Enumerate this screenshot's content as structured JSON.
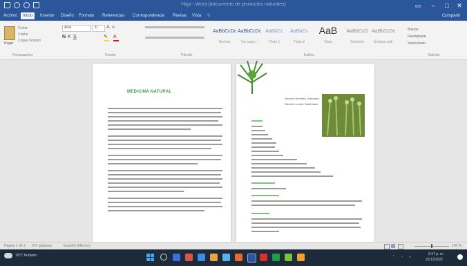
{
  "window": {
    "title": "Hoja - Word (documento de productos naturales)",
    "controls": [
      "minimize",
      "maximize",
      "close"
    ]
  },
  "quick_access": [
    "save-icon",
    "undo-icon",
    "redo-icon",
    "customize-icon"
  ],
  "ribbon_tabs": [
    "Archivo",
    "Inicio",
    "Insertar",
    "Diseño",
    "Formato",
    "Referencias",
    "Correspondencia",
    "Revisar",
    "Vista"
  ],
  "share_label": "Compartir",
  "ribbon": {
    "clipboard_label": "Portapapeles",
    "font_label": "Fuente",
    "paragraph_label": "Párrafo",
    "styles_label": "Estilos",
    "editing_label": "Edición",
    "paste_label": "Pegar",
    "cut_label": "Cortar",
    "copy_label": "Copiar",
    "format_painter_label": "Copiar formato",
    "font_name": "Arial",
    "font_size": "11",
    "styles": [
      {
        "sample": "AaBbCcDc",
        "name": "Normal"
      },
      {
        "sample": "AaBbCcDc",
        "name": "Sin espa..."
      },
      {
        "sample": "AaBbCc",
        "name": "Título 1"
      },
      {
        "sample": "AaBbCc",
        "name": "Título 2"
      },
      {
        "sample": "AaB",
        "name": "Título"
      },
      {
        "sample": "AaBbCcD",
        "name": "Subtítulo"
      },
      {
        "sample": "AaBbCcDc",
        "name": "Énfasis sutil"
      }
    ],
    "find_label": "Buscar",
    "replace_label": "Reemplazar",
    "select_label": "Seleccionar"
  },
  "document": {
    "page1_title": "MEDICINA NATURAL",
    "page2_image_caption_1": "Nombre científico: Artemisia",
    "page2_image_caption_2": "Nombre común: Marihuana"
  },
  "status": {
    "page": "Página 1 de 2",
    "words": "379 palabras",
    "language": "Español (México)",
    "zoom": "100 %"
  },
  "taskbar": {
    "weather": "19°C Nublado",
    "time": "9:17 p. m.",
    "date": "22/12/2022"
  },
  "colors": {
    "word_blue": "#2b579a",
    "green_text": "#3e9a3e",
    "taskbar": "#1d2a3a"
  }
}
